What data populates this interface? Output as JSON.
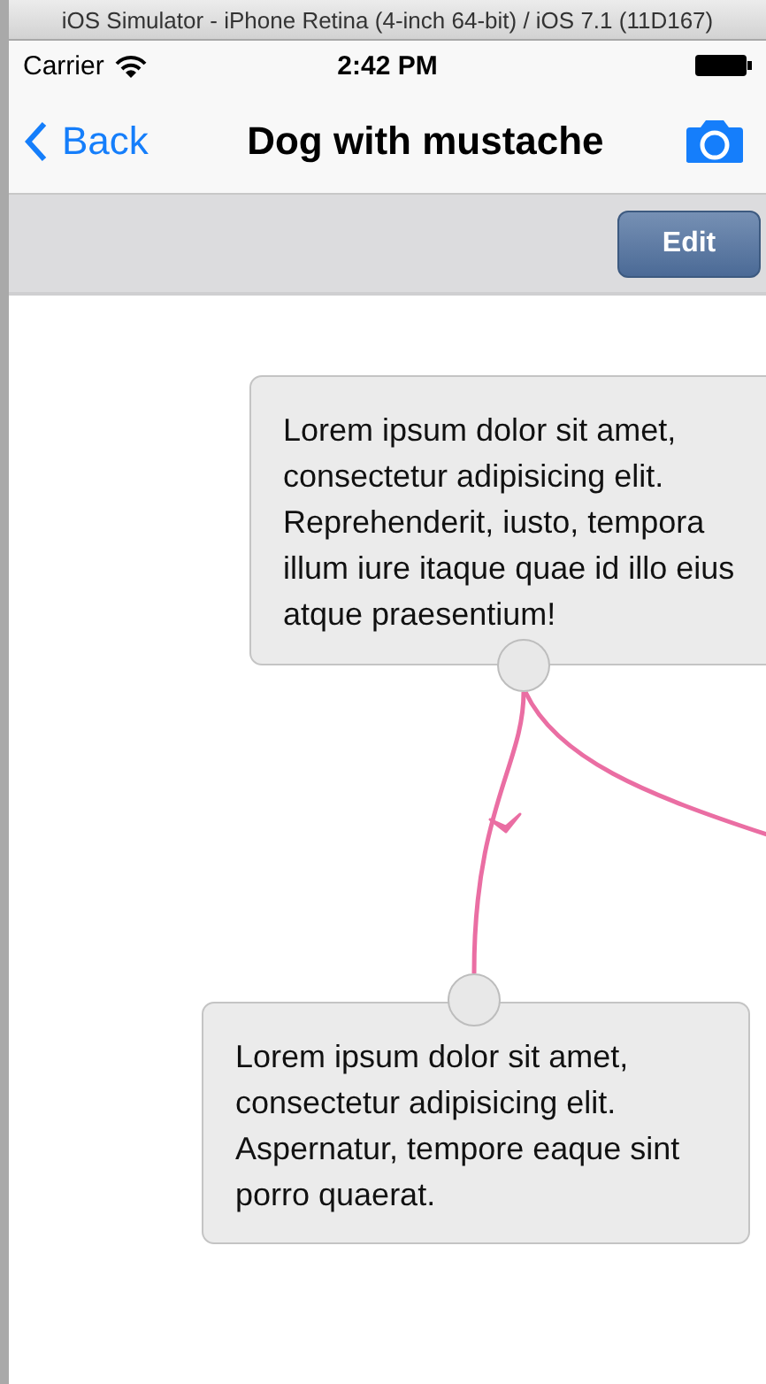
{
  "window": {
    "title": "iOS Simulator - iPhone Retina (4-inch 64-bit) / iOS 7.1 (11D167)"
  },
  "status_bar": {
    "carrier": "Carrier",
    "time": "2:42 PM"
  },
  "nav_bar": {
    "back": "Back",
    "title": "Dog with mustache"
  },
  "toolbar": {
    "buttons": [
      "Edit"
    ]
  },
  "canvas": {
    "nodes": [
      {
        "text": "Lorem ipsum dolor sit amet, consectetur adipisicing elit. Reprehenderit, iusto, tempora illum iure itaque quae id illo eius atque praesentium!"
      },
      {
        "text": "Lorem ipsum dolor sit amet, consectetur adipisicing elit. Aspernatur, tempore eaque sint porro quaerat."
      }
    ],
    "connectors": [
      {
        "arrow": true
      },
      {
        "arrow": false
      }
    ]
  }
}
